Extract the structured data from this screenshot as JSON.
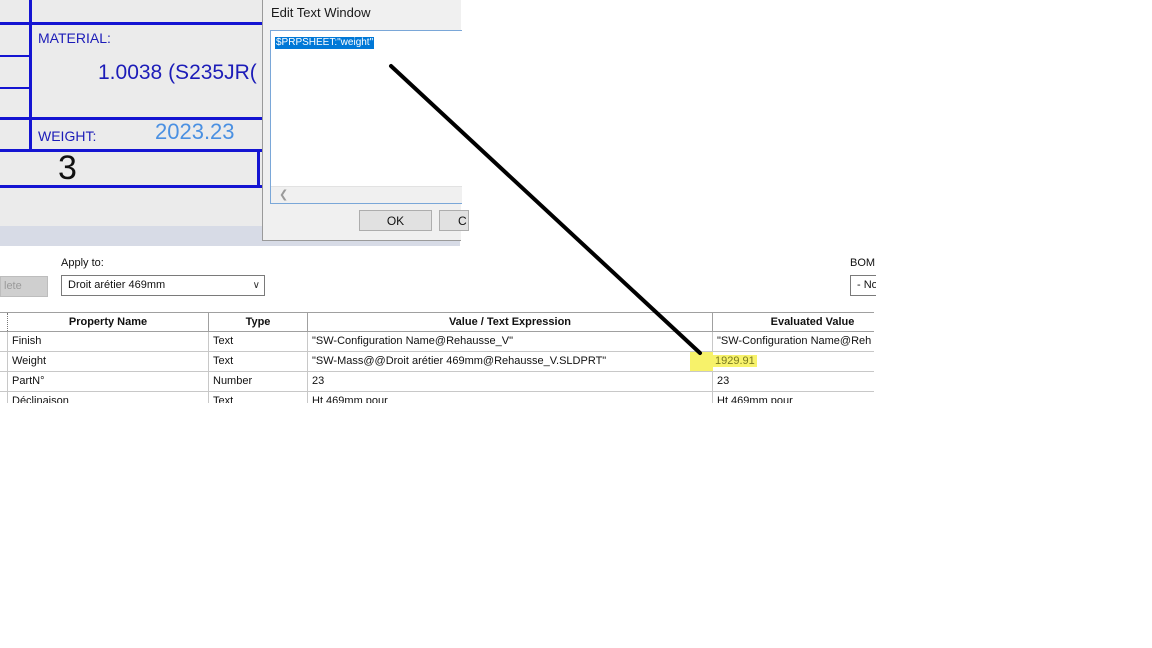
{
  "drawing": {
    "title_number": "3",
    "material_label": "MATERIAL:",
    "material_value": "1.0038 (S235JR(",
    "weight_label": "WEIGHT:",
    "weight_value": "2023.23",
    "colors": {
      "border": "#1414d2",
      "text": "#1c1cb8",
      "weight_value": "#4a90e2"
    }
  },
  "edit_dialog": {
    "title": "Edit Text Window",
    "selected_text": "$PRPSHEET:\"weight\"",
    "ok_label": "OK",
    "cancel_label": "C"
  },
  "properties": {
    "delete_label": "lete",
    "apply_to_label": "Apply to:",
    "apply_to_value": "Droit arétier 469mm",
    "bom_label": "BOM",
    "bom_value": "- No",
    "columns": [
      "Property Name",
      "Type",
      "Value / Text Expression",
      "Evaluated Value"
    ],
    "rows": [
      {
        "name": "Finish",
        "type": "Text",
        "value": "\"SW-Configuration Name@Rehausse_V\"",
        "evaluated": "\"SW-Configuration Name@Reh"
      },
      {
        "name": "Weight",
        "type": "Text",
        "value": "\"SW-Mass@@Droit arétier 469mm@Rehausse_V.SLDPRT\"",
        "evaluated": "1929.91"
      },
      {
        "name": "PartN°",
        "type": "Number",
        "value": "23",
        "evaluated": "23"
      },
      {
        "name": "Déclinaison",
        "type": "Text",
        "value": "Ht 469mm pour",
        "evaluated": "Ht 469mm pour"
      }
    ],
    "highlight_color": "#f7f26a"
  }
}
